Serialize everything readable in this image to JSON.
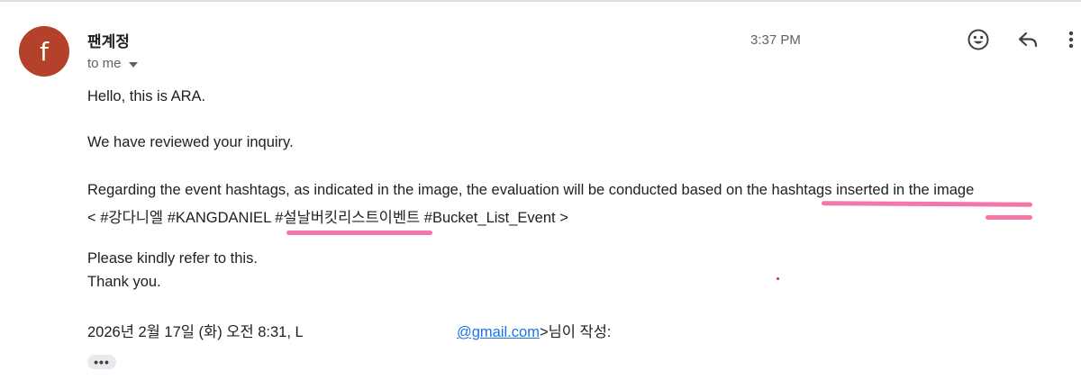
{
  "sender": {
    "avatar_letter": "f",
    "name": "팬계정",
    "avatar_color": "#b4412a"
  },
  "recipient": {
    "label": "to me"
  },
  "timestamp": "3:37 PM",
  "actions": {
    "emoji_icon": "smiley-icon",
    "reply_icon": "reply-icon",
    "more_icon": "more-vert-icon"
  },
  "message": {
    "greeting": "Hello, this is ARA.",
    "line2": "We have reviewed your inquiry.",
    "line3": "Regarding the event hashtags, as indicated in the image, the evaluation will be conducted based on the hashtags inserted in the image",
    "hashtags": "< #강다니엘 #KANGDANIEL #설날버킷리스트이벤트 #Bucket_List_Event >",
    "line5": "Please kindly refer to this.",
    "line6": "Thank you.",
    "quote_prefix": "2026년 2월 17일 (화) 오전 8:31, L",
    "quote_email": "@gmail.com",
    "quote_suffix": ">님이 작성:"
  },
  "show_trimmed": "•••",
  "colors": {
    "highlighter": "#f0609a",
    "link": "#1a73e8"
  }
}
